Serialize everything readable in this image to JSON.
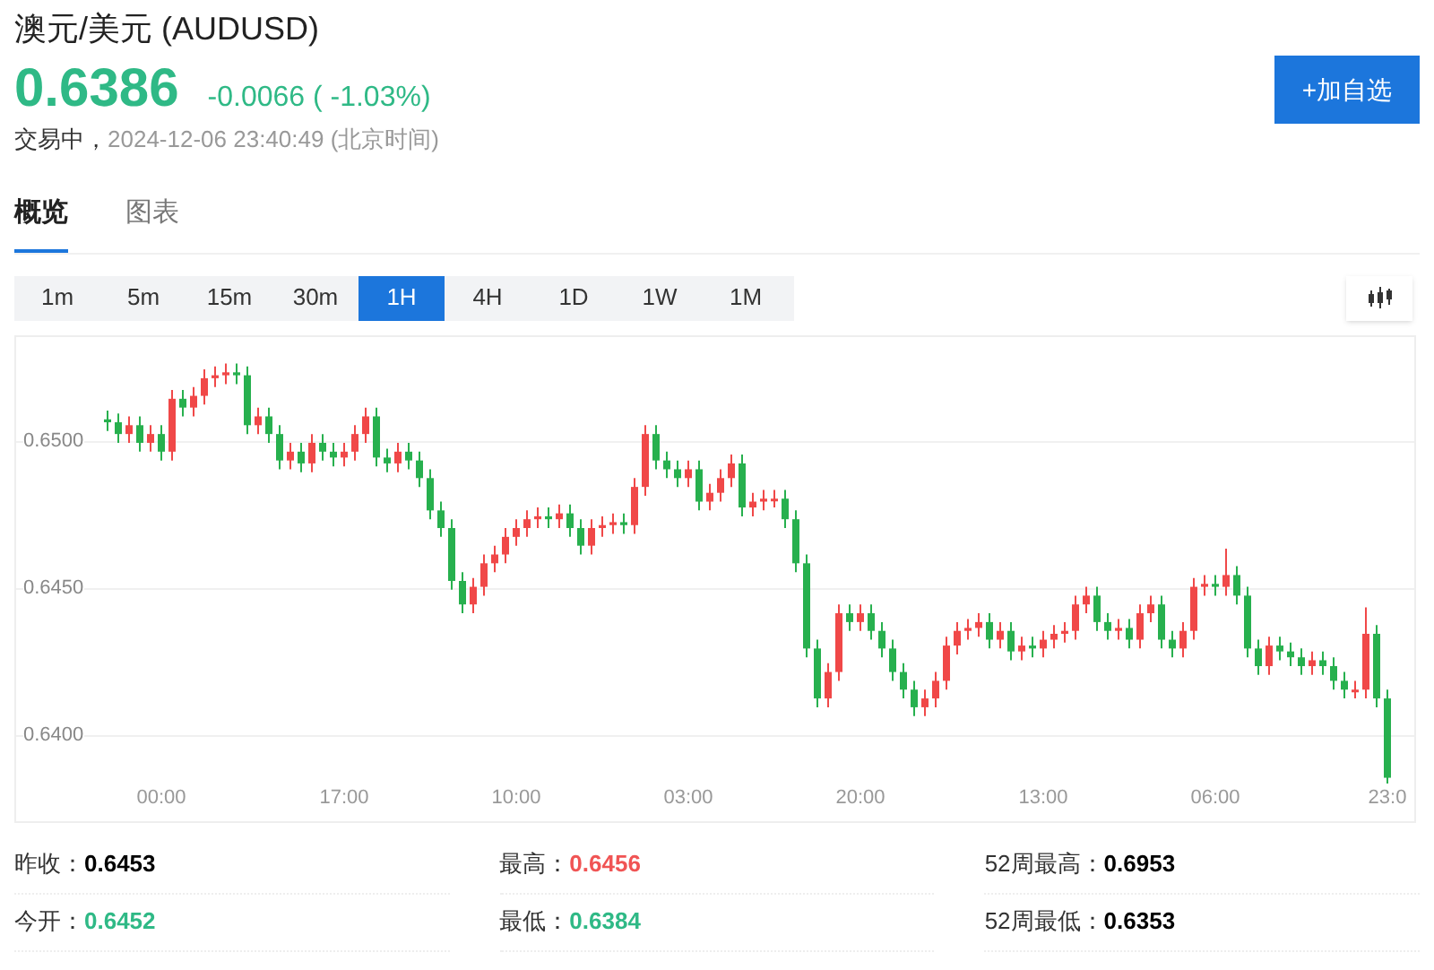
{
  "quote": {
    "title": "澳元/美元 (AUDUSD)",
    "price": "0.6386",
    "change": "-0.0066 ( -1.03%)",
    "color": "#2fb986",
    "status": "交易中，",
    "timestamp": "2024-12-06 23:40:49 (北京时间)"
  },
  "watch_button": "+加自选",
  "tabs": [
    {
      "label": "概览",
      "selected": true
    },
    {
      "label": "图表",
      "selected": false
    }
  ],
  "intervals": [
    {
      "label": "1m",
      "selected": false
    },
    {
      "label": "5m",
      "selected": false
    },
    {
      "label": "15m",
      "selected": false
    },
    {
      "label": "30m",
      "selected": false
    },
    {
      "label": "1H",
      "selected": true
    },
    {
      "label": "4H",
      "selected": false
    },
    {
      "label": "1D",
      "selected": false
    },
    {
      "label": "1W",
      "selected": false
    },
    {
      "label": "1M",
      "selected": false
    }
  ],
  "chart": {
    "chart_data": {
      "type": "candlestick",
      "ylim": [
        0.637,
        0.6536
      ],
      "grid": true,
      "yticks": [
        {
          "value": 0.65,
          "label": "0.6500"
        },
        {
          "value": 0.645,
          "label": "0.6450"
        },
        {
          "value": 0.64,
          "label": "0.6400"
        }
      ],
      "categories": [
        null,
        null,
        null,
        null,
        null,
        "00:00",
        null,
        null,
        null,
        null,
        null,
        null,
        null,
        null,
        null,
        null,
        null,
        null,
        null,
        null,
        null,
        null,
        "17:00",
        null,
        null,
        null,
        null,
        null,
        null,
        null,
        null,
        null,
        null,
        null,
        null,
        null,
        null,
        null,
        "10:00",
        null,
        null,
        null,
        null,
        null,
        null,
        null,
        null,
        null,
        null,
        null,
        null,
        null,
        null,
        null,
        "03:00",
        null,
        null,
        null,
        null,
        null,
        null,
        null,
        null,
        null,
        null,
        null,
        null,
        null,
        null,
        null,
        "20:00",
        null,
        null,
        null,
        null,
        null,
        null,
        null,
        null,
        null,
        null,
        null,
        null,
        null,
        null,
        null,
        null,
        "13:00",
        null,
        null,
        null,
        null,
        null,
        null,
        null,
        null,
        null,
        null,
        null,
        null,
        null,
        null,
        null,
        "06:00",
        null,
        null,
        null,
        null,
        null,
        null,
        null,
        null,
        null,
        null,
        null,
        null,
        null,
        null,
        null,
        "23:0"
      ],
      "ohlc": [
        [
          0.6508,
          0.6511,
          0.6504,
          0.6507
        ],
        [
          0.6507,
          0.651,
          0.65,
          0.6503
        ],
        [
          0.6503,
          0.6509,
          0.65,
          0.6506
        ],
        [
          0.6506,
          0.6509,
          0.6497,
          0.65
        ],
        [
          0.65,
          0.6506,
          0.6497,
          0.6503
        ],
        [
          0.6503,
          0.6506,
          0.6494,
          0.6497
        ],
        [
          0.6497,
          0.6518,
          0.6494,
          0.6515
        ],
        [
          0.6515,
          0.6518,
          0.6509,
          0.6512
        ],
        [
          0.6512,
          0.6519,
          0.6509,
          0.6516
        ],
        [
          0.6516,
          0.6525,
          0.6513,
          0.6522
        ],
        [
          0.6522,
          0.6526,
          0.6519,
          0.6523
        ],
        [
          0.6523,
          0.6527,
          0.652,
          0.6524
        ],
        [
          0.6524,
          0.6527,
          0.652,
          0.6523
        ],
        [
          0.6523,
          0.6526,
          0.6503,
          0.6506
        ],
        [
          0.6506,
          0.6512,
          0.6503,
          0.6509
        ],
        [
          0.6509,
          0.6512,
          0.65,
          0.6503
        ],
        [
          0.6503,
          0.6506,
          0.6491,
          0.6494
        ],
        [
          0.6494,
          0.65,
          0.6491,
          0.6497
        ],
        [
          0.6497,
          0.65,
          0.649,
          0.6493
        ],
        [
          0.6493,
          0.6503,
          0.649,
          0.65
        ],
        [
          0.65,
          0.6503,
          0.6494,
          0.6497
        ],
        [
          0.6497,
          0.65,
          0.6492,
          0.6495
        ],
        [
          0.6495,
          0.65,
          0.6492,
          0.6497
        ],
        [
          0.6497,
          0.6506,
          0.6494,
          0.6503
        ],
        [
          0.6503,
          0.6512,
          0.65,
          0.6509
        ],
        [
          0.6509,
          0.6512,
          0.6492,
          0.6495
        ],
        [
          0.6495,
          0.6498,
          0.649,
          0.6493
        ],
        [
          0.6493,
          0.65,
          0.649,
          0.6497
        ],
        [
          0.6497,
          0.65,
          0.6491,
          0.6494
        ],
        [
          0.6494,
          0.6497,
          0.6485,
          0.6488
        ],
        [
          0.6488,
          0.6491,
          0.6474,
          0.6477
        ],
        [
          0.6477,
          0.648,
          0.6468,
          0.6471
        ],
        [
          0.6471,
          0.6474,
          0.645,
          0.6453
        ],
        [
          0.6453,
          0.6456,
          0.6442,
          0.6445
        ],
        [
          0.6445,
          0.6454,
          0.6442,
          0.6451
        ],
        [
          0.6451,
          0.6462,
          0.6448,
          0.6459
        ],
        [
          0.6459,
          0.6465,
          0.6456,
          0.6462
        ],
        [
          0.6462,
          0.6471,
          0.6459,
          0.6468
        ],
        [
          0.6468,
          0.6474,
          0.6465,
          0.6471
        ],
        [
          0.6471,
          0.6477,
          0.6468,
          0.6474
        ],
        [
          0.6474,
          0.6478,
          0.6471,
          0.6475
        ],
        [
          0.6475,
          0.6478,
          0.6471,
          0.6474
        ],
        [
          0.6474,
          0.6479,
          0.6471,
          0.6476
        ],
        [
          0.6476,
          0.6479,
          0.6468,
          0.6471
        ],
        [
          0.6471,
          0.6474,
          0.6462,
          0.6465
        ],
        [
          0.6465,
          0.6474,
          0.6462,
          0.6471
        ],
        [
          0.6471,
          0.6475,
          0.6468,
          0.6472
        ],
        [
          0.6472,
          0.6476,
          0.6469,
          0.6473
        ],
        [
          0.6473,
          0.6476,
          0.6469,
          0.6472
        ],
        [
          0.6472,
          0.6488,
          0.6469,
          0.6485
        ],
        [
          0.6485,
          0.6506,
          0.6482,
          0.6503
        ],
        [
          0.6503,
          0.6506,
          0.6491,
          0.6494
        ],
        [
          0.6494,
          0.6497,
          0.6488,
          0.6491
        ],
        [
          0.6491,
          0.6494,
          0.6485,
          0.6488
        ],
        [
          0.6488,
          0.6494,
          0.6485,
          0.6491
        ],
        [
          0.6491,
          0.6494,
          0.6477,
          0.648
        ],
        [
          0.648,
          0.6486,
          0.6477,
          0.6483
        ],
        [
          0.6483,
          0.6491,
          0.648,
          0.6488
        ],
        [
          0.6488,
          0.6496,
          0.6485,
          0.6493
        ],
        [
          0.6493,
          0.6496,
          0.6475,
          0.6478
        ],
        [
          0.6478,
          0.6483,
          0.6475,
          0.648
        ],
        [
          0.648,
          0.6484,
          0.6477,
          0.6481
        ],
        [
          0.6481,
          0.6484,
          0.6478,
          0.6481
        ],
        [
          0.6481,
          0.6484,
          0.6471,
          0.6474
        ],
        [
          0.6474,
          0.6477,
          0.6456,
          0.6459
        ],
        [
          0.6459,
          0.6462,
          0.6427,
          0.643
        ],
        [
          0.643,
          0.6433,
          0.641,
          0.6413
        ],
        [
          0.6413,
          0.6425,
          0.641,
          0.6422
        ],
        [
          0.6422,
          0.6445,
          0.6419,
          0.6442
        ],
        [
          0.6442,
          0.6445,
          0.6436,
          0.6439
        ],
        [
          0.6439,
          0.6445,
          0.6436,
          0.6442
        ],
        [
          0.6442,
          0.6445,
          0.6433,
          0.6436
        ],
        [
          0.6436,
          0.6439,
          0.6427,
          0.643
        ],
        [
          0.643,
          0.6433,
          0.6419,
          0.6422
        ],
        [
          0.6422,
          0.6425,
          0.6413,
          0.6416
        ],
        [
          0.6416,
          0.6419,
          0.6407,
          0.641
        ],
        [
          0.641,
          0.6416,
          0.6407,
          0.6413
        ],
        [
          0.6413,
          0.6422,
          0.641,
          0.6419
        ],
        [
          0.6419,
          0.6434,
          0.6416,
          0.6431
        ],
        [
          0.6431,
          0.6439,
          0.6428,
          0.6436
        ],
        [
          0.6436,
          0.644,
          0.6433,
          0.6437
        ],
        [
          0.6437,
          0.6442,
          0.6434,
          0.6439
        ],
        [
          0.6439,
          0.6442,
          0.643,
          0.6433
        ],
        [
          0.6433,
          0.6439,
          0.643,
          0.6436
        ],
        [
          0.6436,
          0.6439,
          0.6426,
          0.6429
        ],
        [
          0.6429,
          0.6434,
          0.6426,
          0.6431
        ],
        [
          0.6431,
          0.6434,
          0.6427,
          0.643
        ],
        [
          0.643,
          0.6436,
          0.6427,
          0.6433
        ],
        [
          0.6433,
          0.6438,
          0.643,
          0.6435
        ],
        [
          0.6435,
          0.6439,
          0.6432,
          0.6436
        ],
        [
          0.6436,
          0.6448,
          0.6433,
          0.6445
        ],
        [
          0.6445,
          0.6451,
          0.6442,
          0.6448
        ],
        [
          0.6448,
          0.6451,
          0.6436,
          0.6439
        ],
        [
          0.6439,
          0.6442,
          0.6433,
          0.6436
        ],
        [
          0.6436,
          0.644,
          0.6433,
          0.6437
        ],
        [
          0.6437,
          0.644,
          0.643,
          0.6433
        ],
        [
          0.6433,
          0.6445,
          0.643,
          0.6442
        ],
        [
          0.6442,
          0.6448,
          0.6439,
          0.6445
        ],
        [
          0.6445,
          0.6448,
          0.643,
          0.6433
        ],
        [
          0.6433,
          0.6436,
          0.6427,
          0.643
        ],
        [
          0.643,
          0.6439,
          0.6427,
          0.6436
        ],
        [
          0.6436,
          0.6454,
          0.6433,
          0.6451
        ],
        [
          0.6451,
          0.6455,
          0.6448,
          0.6452
        ],
        [
          0.6452,
          0.6455,
          0.6448,
          0.6451
        ],
        [
          0.6451,
          0.6464,
          0.6448,
          0.6455
        ],
        [
          0.6455,
          0.6458,
          0.6445,
          0.6448
        ],
        [
          0.6448,
          0.6451,
          0.6427,
          0.643
        ],
        [
          0.643,
          0.6433,
          0.6421,
          0.6424
        ],
        [
          0.6424,
          0.6434,
          0.6421,
          0.6431
        ],
        [
          0.6431,
          0.6434,
          0.6426,
          0.6429
        ],
        [
          0.6429,
          0.6432,
          0.6424,
          0.6427
        ],
        [
          0.6427,
          0.643,
          0.6421,
          0.6424
        ],
        [
          0.6424,
          0.6429,
          0.6421,
          0.6426
        ],
        [
          0.6426,
          0.6429,
          0.6421,
          0.6424
        ],
        [
          0.6424,
          0.6427,
          0.6416,
          0.6419
        ],
        [
          0.6419,
          0.6422,
          0.6413,
          0.6416
        ],
        [
          0.6416,
          0.6419,
          0.6413,
          0.6416
        ],
        [
          0.6416,
          0.6444,
          0.6413,
          0.6435
        ],
        [
          0.6435,
          0.6438,
          0.641,
          0.6413
        ],
        [
          0.6413,
          0.6416,
          0.6384,
          0.6386
        ]
      ]
    }
  },
  "stats": [
    {
      "label": "昨收：",
      "value": "0.6453",
      "color": "#000000"
    },
    {
      "label": "最高：",
      "value": "0.6456",
      "color": "#f05454"
    },
    {
      "label": "52周最高：",
      "value": "0.6953",
      "color": "#000000"
    },
    {
      "label": "今开：",
      "value": "0.6452",
      "color": "#2fb986"
    },
    {
      "label": "最低：",
      "value": "0.6384",
      "color": "#2fb986"
    },
    {
      "label": "52周最低：",
      "value": "0.6353",
      "color": "#000000"
    }
  ]
}
